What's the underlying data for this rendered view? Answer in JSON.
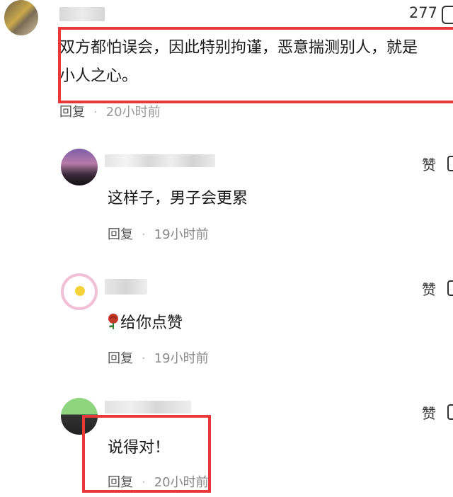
{
  "top_comment": {
    "like_count": "277",
    "text_line1": "双方都怕误会，因此特别拘谨，恶意揣测别人，就是",
    "text_line2": "小人之心。",
    "reply_label": "回复",
    "time": "20小时前"
  },
  "replies": [
    {
      "text": "这样子，男子会更累",
      "like_label": "赞",
      "reply_label": "回复",
      "time": "19小时前"
    },
    {
      "text": "给你点赞",
      "like_label": "赞",
      "reply_label": "回复",
      "time": "19小时前"
    },
    {
      "text": "说得对！",
      "like_label": "赞",
      "reply_label": "回复",
      "time": "20小时前"
    }
  ],
  "colors": {
    "highlight": "#e8383a",
    "meta_text": "#888888"
  }
}
